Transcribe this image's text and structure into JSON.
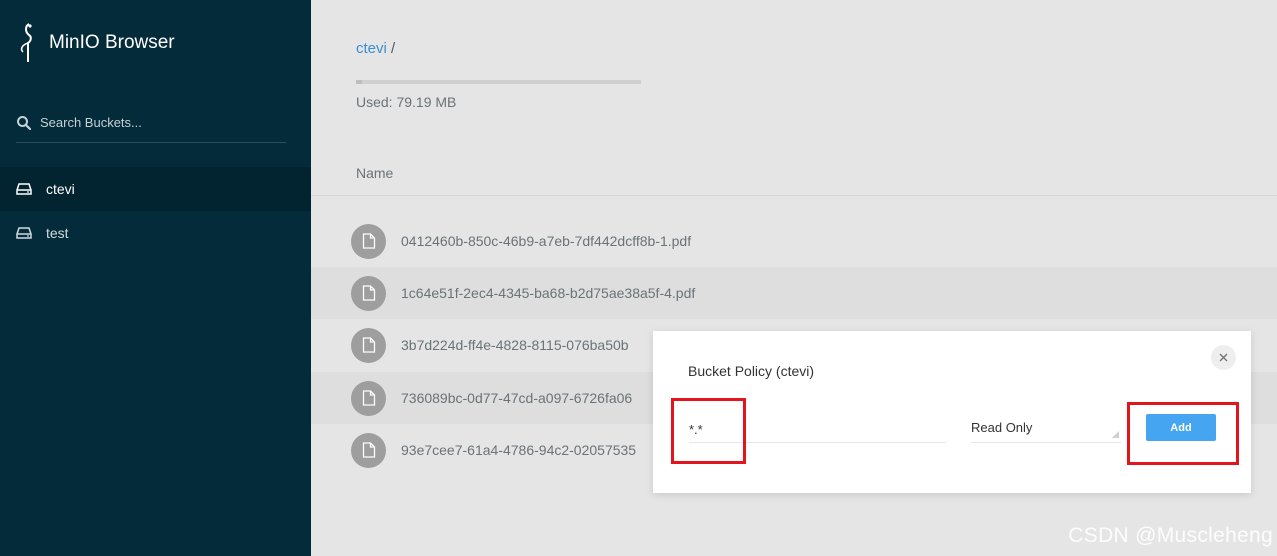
{
  "app": {
    "title": "MinIO Browser"
  },
  "sidebar": {
    "search_placeholder": "Search Buckets...",
    "buckets": [
      {
        "label": "ctevi",
        "active": true
      },
      {
        "label": "test",
        "active": false
      }
    ]
  },
  "main": {
    "breadcrumb": {
      "bucket": "ctevi",
      "separator": "/"
    },
    "usage": {
      "text": "Used: 79.19 MB"
    },
    "column_header": "Name",
    "files": [
      "0412460b-850c-46b9-a7eb-7df442dcff8b-1.pdf",
      "1c64e51f-2ec4-4345-ba68-b2d75ae38a5f-4.pdf",
      "3b7d224d-ff4e-4828-8115-076ba50b",
      "736089bc-0d77-47cd-a097-6726fa06",
      "93e7cee7-61a4-4786-94c2-02057535"
    ]
  },
  "modal": {
    "title": "Bucket Policy (ctevi)",
    "prefix_value": "*.*",
    "policy_value": "Read Only",
    "add_label": "Add"
  },
  "watermark": "CSDN @Muscleheng",
  "colors": {
    "sidebar_bg": "#032b39",
    "accent_link": "#3a8ed6",
    "add_button": "#46a5f1",
    "highlight_red": "#e2151c"
  },
  "icons": {
    "logo": "minio-bird-icon",
    "search": "search-icon",
    "bucket": "drive-icon",
    "file": "file-icon",
    "close": "close-icon"
  }
}
